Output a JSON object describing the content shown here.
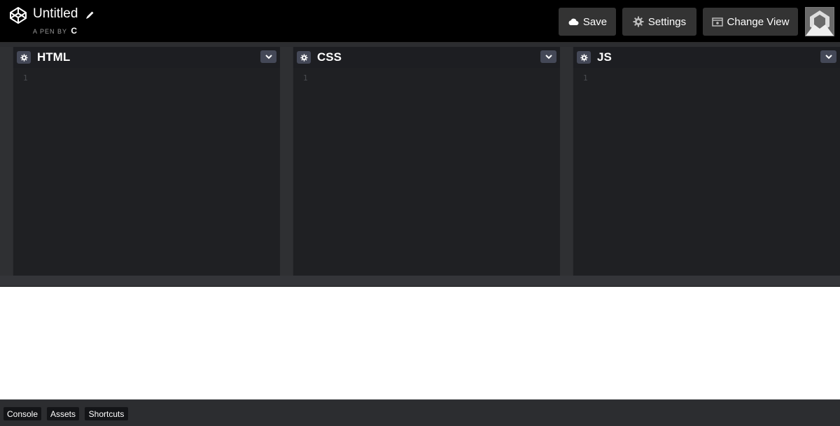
{
  "header": {
    "title": "Untitled",
    "byline_prefix": "A PEN BY",
    "author": "C",
    "buttons": {
      "save": "Save",
      "settings": "Settings",
      "change_view": "Change View"
    }
  },
  "editors": [
    {
      "title": "HTML",
      "line_number": "1"
    },
    {
      "title": "CSS",
      "line_number": "1"
    },
    {
      "title": "JS",
      "line_number": "1"
    }
  ],
  "footer": {
    "console": "Console",
    "assets": "Assets",
    "shortcuts": "Shortcuts"
  },
  "icons": {
    "logo": "codepen-logo-icon",
    "edit_title": "pencil-icon",
    "save": "cloud-icon",
    "settings": "gear-icon",
    "change_view": "layout-icon",
    "pane_settings": "gear-icon",
    "pane_collapse": "chevron-down-icon"
  },
  "colors": {
    "header_bg": "#000000",
    "button_bg": "#333333",
    "editor_bg": "#1f2023",
    "pane_control_bg": "#444857",
    "footer_bg": "#2c2d30",
    "footer_button_bg": "#131417"
  }
}
